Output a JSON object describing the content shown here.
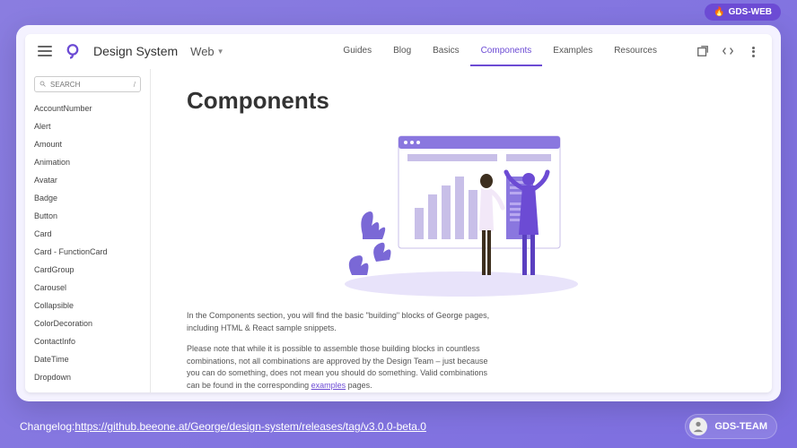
{
  "topBadge": {
    "icon": "🔥",
    "label": "GDS-WEB"
  },
  "header": {
    "brand": "Design System",
    "platform": "Web",
    "nav": [
      "Guides",
      "Blog",
      "Basics",
      "Components",
      "Examples",
      "Resources"
    ],
    "activeNav": "Components"
  },
  "sidebar": {
    "searchPlaceholder": "SEARCH",
    "items": [
      "AccountNumber",
      "Alert",
      "Amount",
      "Animation",
      "Avatar",
      "Badge",
      "Button",
      "Card",
      "Card - FunctionCard",
      "CardGroup",
      "Carousel",
      "Collapsible",
      "ColorDecoration",
      "ContactInfo",
      "DateTime",
      "Dropdown"
    ]
  },
  "content": {
    "title": "Components",
    "p1": "In the Components section, you will find the basic \"building\" blocks of George pages, including HTML & React sample snippets.",
    "p2a": "Please note that while it is possible to assemble those building blocks in countless combinations, not all combinations are approved by the Design Team – just because you can do something, does not mean you should do something. Valid combinations can be found in the corresponding ",
    "p2link": "examples",
    "p2b": " pages."
  },
  "footer": {
    "changelogLabel": "Changelog: ",
    "changelogUrl": "https://github.beeone.at/George/design-system/releases/tag/v3.0.0-beta.0",
    "teamLabel": "GDS-TEAM"
  }
}
